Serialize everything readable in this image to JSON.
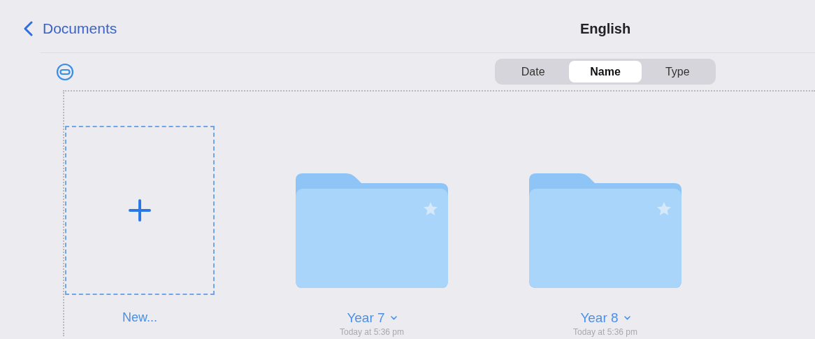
{
  "navigation": {
    "back_label": "Documents",
    "title": "English"
  },
  "sort_options": [
    {
      "label": "Date",
      "selected": false
    },
    {
      "label": "Name",
      "selected": true
    },
    {
      "label": "Type",
      "selected": false
    }
  ],
  "new_item": {
    "label": "New..."
  },
  "folders": [
    {
      "name": "Year 7",
      "date": "Today at 5:36 pm"
    },
    {
      "name": "Year 8",
      "date": "Today at 5:36 pm"
    }
  ]
}
